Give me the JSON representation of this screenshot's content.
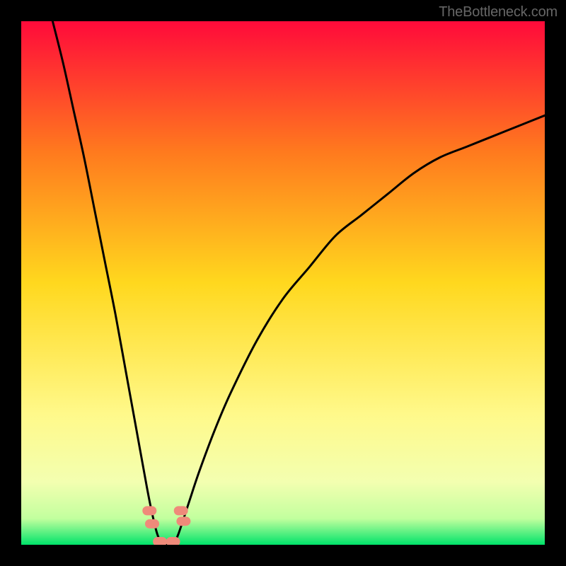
{
  "attribution": "TheBottleneck.com",
  "chart_data": {
    "type": "line",
    "title": "",
    "xlabel": "",
    "ylabel": "",
    "xlim": [
      0,
      100
    ],
    "ylim": [
      0,
      100
    ],
    "gradient_stops": [
      {
        "offset": 0,
        "color": "#ff0a3a"
      },
      {
        "offset": 25,
        "color": "#ff7a1e"
      },
      {
        "offset": 50,
        "color": "#ffd81e"
      },
      {
        "offset": 75,
        "color": "#fff98a"
      },
      {
        "offset": 88,
        "color": "#f3ffb0"
      },
      {
        "offset": 95,
        "color": "#c2ff9e"
      },
      {
        "offset": 100,
        "color": "#00e36a"
      }
    ],
    "series": [
      {
        "name": "curve-left",
        "x": [
          6,
          8,
          10,
          12,
          14,
          16,
          18,
          20,
          22,
          24,
          25,
          26,
          27,
          28
        ],
        "values": [
          100,
          92,
          83,
          74,
          64,
          54,
          44,
          33,
          22,
          11,
          6,
          2,
          0,
          0
        ]
      },
      {
        "name": "curve-right",
        "x": [
          29,
          30,
          32,
          34,
          37,
          40,
          45,
          50,
          55,
          60,
          65,
          70,
          75,
          80,
          85,
          90,
          95,
          100
        ],
        "values": [
          0,
          2,
          8,
          14,
          22,
          29,
          39,
          47,
          53,
          59,
          63,
          67,
          71,
          74,
          76,
          78,
          80,
          82
        ]
      }
    ],
    "markers": [
      {
        "x": 24.5,
        "y": 6.5
      },
      {
        "x": 25.0,
        "y": 4.0
      },
      {
        "x": 30.5,
        "y": 6.5
      },
      {
        "x": 31.0,
        "y": 4.5
      },
      {
        "x": 26.5,
        "y": 0.6
      },
      {
        "x": 29.0,
        "y": 0.6
      }
    ],
    "marker_color": "#ef8a7a",
    "curve_color": "#000000"
  }
}
